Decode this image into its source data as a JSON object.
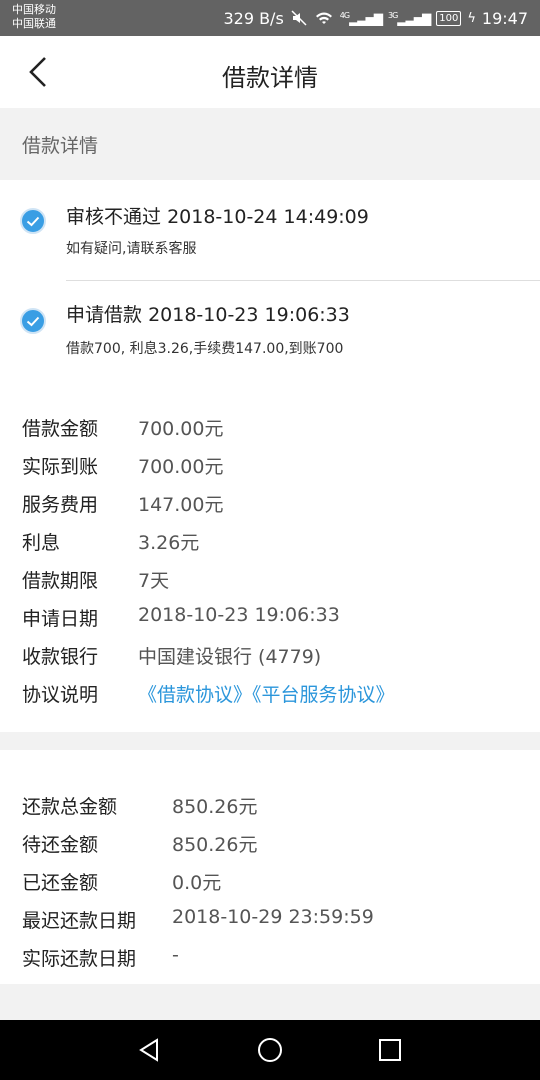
{
  "status": {
    "carrier1": "中国移动",
    "carrier2": "中国联通",
    "speed": "329 B/s",
    "net1": "4G",
    "net2": "3G",
    "battery": "100",
    "time": "19:47"
  },
  "header": {
    "title": "借款详情"
  },
  "section": {
    "title": "借款详情"
  },
  "timeline": [
    {
      "status": "审核不通过",
      "time": "2018-10-24 14:49:09",
      "note": "如有疑问,请联系客服"
    },
    {
      "status": "申请借款",
      "time": "2018-10-23 19:06:33",
      "note": "借款700, 利息3.26,手续费147.00,到账700"
    }
  ],
  "loan": [
    {
      "label": "借款金额",
      "value": "700.00元"
    },
    {
      "label": "实际到账",
      "value": "700.00元"
    },
    {
      "label": "服务费用",
      "value": "147.00元"
    },
    {
      "label": "利息",
      "value": "3.26元"
    },
    {
      "label": "借款期限",
      "value": "7天"
    },
    {
      "label": "申请日期",
      "value": "2018-10-23 19:06:33"
    },
    {
      "label": "收款银行",
      "value": "中国建设银行 (4779)"
    }
  ],
  "agreement": {
    "label": "协议说明",
    "link1": "《借款协议》",
    "link2": "《平台服务协议》"
  },
  "repay": [
    {
      "label": "还款总金额",
      "value": "850.26元"
    },
    {
      "label": "待还金额",
      "value": "850.26元"
    },
    {
      "label": "已还金额",
      "value": "0.0元"
    },
    {
      "label": "最迟还款日期",
      "value": "2018-10-29 23:59:59"
    },
    {
      "label": "实际还款日期",
      "value": "-"
    }
  ],
  "colors": {
    "accent": "#2b96db",
    "check": "#3a9ee4"
  }
}
